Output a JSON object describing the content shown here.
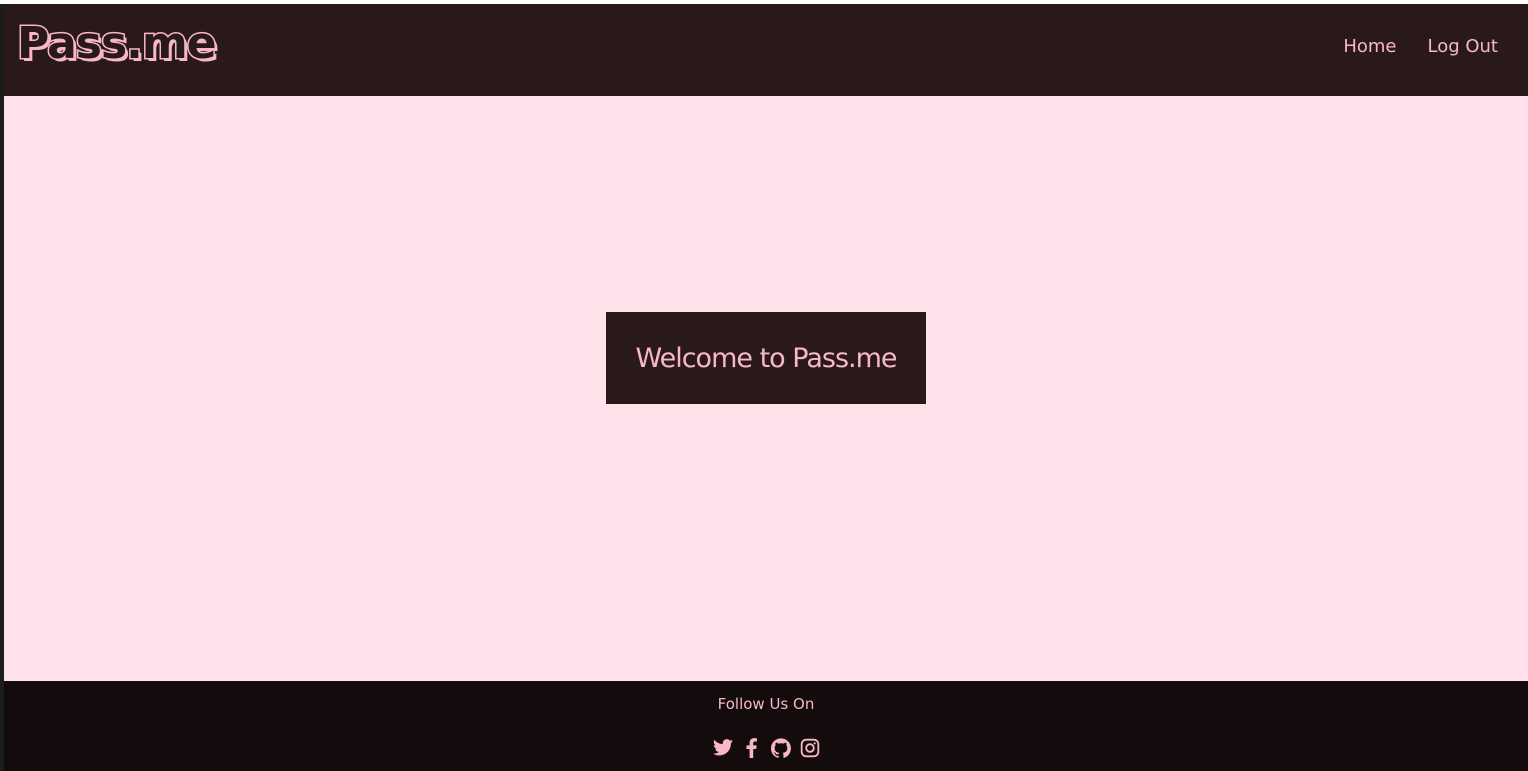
{
  "navbar": {
    "brand": "Pass.me",
    "links": [
      {
        "label": "Home"
      },
      {
        "label": "Log Out"
      }
    ]
  },
  "main": {
    "welcome": "Welcome to Pass.me"
  },
  "footer": {
    "title": "Follow Us On",
    "socials": [
      {
        "icon": "twitter-icon"
      },
      {
        "icon": "facebook-icon"
      },
      {
        "icon": "github-icon"
      },
      {
        "icon": "instagram-icon"
      }
    ]
  },
  "colors": {
    "navbar_bg": "#2a191a",
    "main_bg": "#ffe1ea",
    "footer_bg": "#140b0d",
    "accent_pink": "#f8b7c8"
  }
}
